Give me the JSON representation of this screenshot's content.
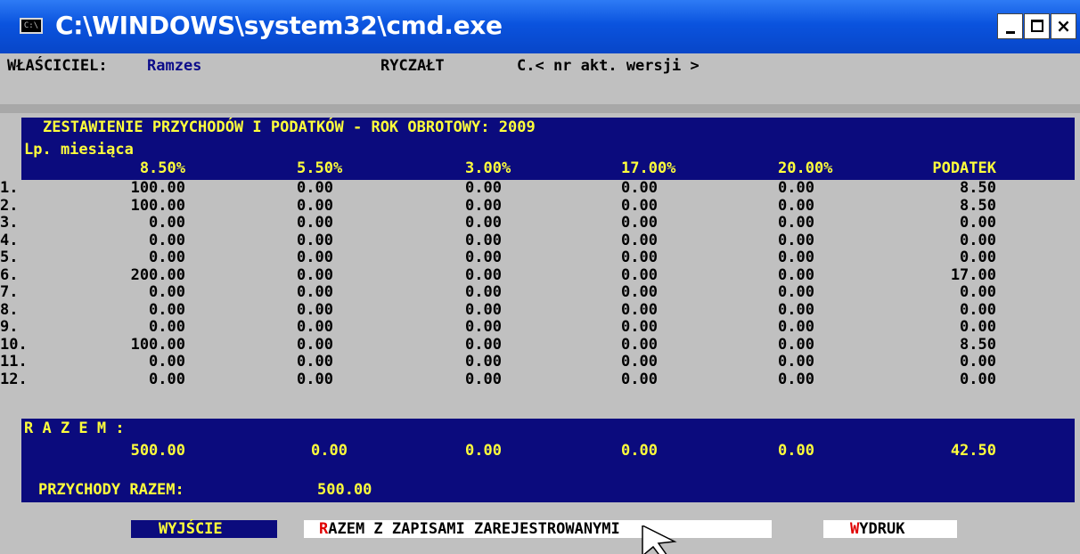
{
  "window": {
    "title": "C:\\WINDOWS\\system32\\cmd.exe",
    "icon": "cmd-icon",
    "controls": {
      "minimize_icon": "minimize-icon",
      "maximize_icon": "maximize-icon",
      "close_icon": "close-icon",
      "close_glyph": "×"
    }
  },
  "header": {
    "owner_label": "WŁAŚCICIEL:",
    "owner_name": "Ramzes",
    "mode": "RYCZAŁT",
    "version": "C.< nr akt. wersji >"
  },
  "report": {
    "title": "ZESTAWIENIE PRZYCHODÓW I PODATKÓW - ROK OBROTOWY: 2009",
    "month_header": "Lp. miesiąca",
    "columns": [
      "8.50%",
      "5.50%",
      "3.00%",
      "17.00%",
      "20.00%",
      "PODATEK"
    ],
    "rows": [
      {
        "lp": "1.",
        "values": [
          "100.00",
          "0.00",
          "0.00",
          "0.00",
          "0.00",
          "8.50"
        ]
      },
      {
        "lp": "2.",
        "values": [
          "100.00",
          "0.00",
          "0.00",
          "0.00",
          "0.00",
          "8.50"
        ]
      },
      {
        "lp": "3.",
        "values": [
          "0.00",
          "0.00",
          "0.00",
          "0.00",
          "0.00",
          "0.00"
        ]
      },
      {
        "lp": "4.",
        "values": [
          "0.00",
          "0.00",
          "0.00",
          "0.00",
          "0.00",
          "0.00"
        ]
      },
      {
        "lp": "5.",
        "values": [
          "0.00",
          "0.00",
          "0.00",
          "0.00",
          "0.00",
          "0.00"
        ]
      },
      {
        "lp": "6.",
        "values": [
          "200.00",
          "0.00",
          "0.00",
          "0.00",
          "0.00",
          "17.00"
        ]
      },
      {
        "lp": "7.",
        "values": [
          "0.00",
          "0.00",
          "0.00",
          "0.00",
          "0.00",
          "0.00"
        ]
      },
      {
        "lp": "8.",
        "values": [
          "0.00",
          "0.00",
          "0.00",
          "0.00",
          "0.00",
          "0.00"
        ]
      },
      {
        "lp": "9.",
        "values": [
          "0.00",
          "0.00",
          "0.00",
          "0.00",
          "0.00",
          "0.00"
        ]
      },
      {
        "lp": "10.",
        "values": [
          "100.00",
          "0.00",
          "0.00",
          "0.00",
          "0.00",
          "8.50"
        ]
      },
      {
        "lp": "11.",
        "values": [
          "0.00",
          "0.00",
          "0.00",
          "0.00",
          "0.00",
          "0.00"
        ]
      },
      {
        "lp": "12.",
        "values": [
          "0.00",
          "0.00",
          "0.00",
          "0.00",
          "0.00",
          "0.00"
        ]
      }
    ],
    "total_label": "R A Z E M :",
    "totals": [
      "500.00",
      "0.00",
      "0.00",
      "0.00",
      "0.00",
      "42.50"
    ],
    "revenue_label": "PRZYCHODY RAZEM:",
    "revenue_value": "500.00"
  },
  "actions": {
    "exit": "WYJŚCIE",
    "with_records_hotkey": "R",
    "with_records_rest": "AZEM Z ZAPISAMI ZAREJESTROWANYMI",
    "print_hotkey": "W",
    "print_rest": "YDRUK"
  },
  "cursor_icon": "mouse-pointer-icon"
}
